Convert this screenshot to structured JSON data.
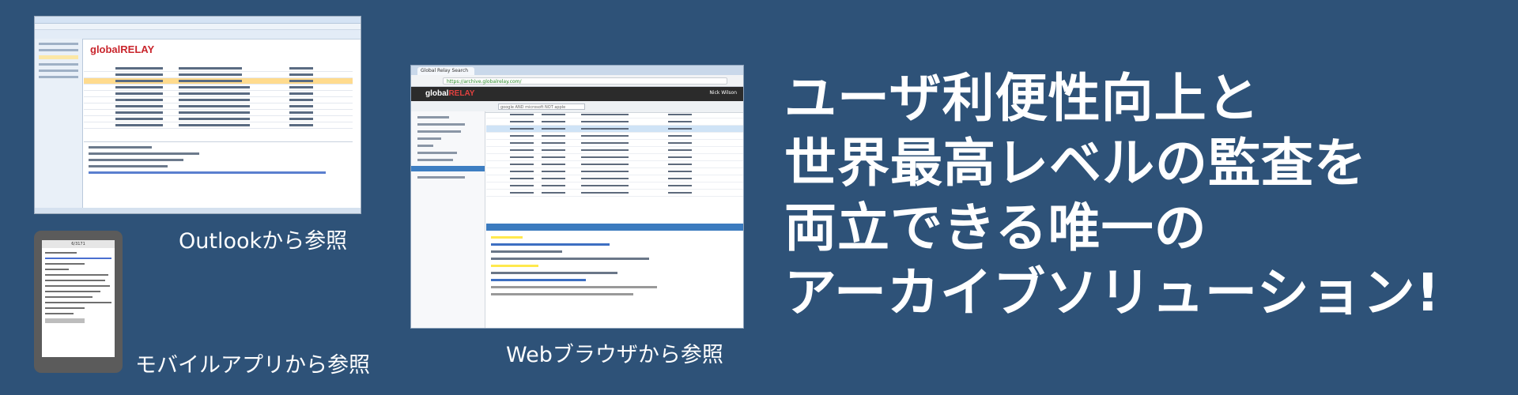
{
  "captions": {
    "outlook": "Outlookから参照",
    "mobile": "モバイルアプリから参照",
    "web": "Webブラウザから参照"
  },
  "headline": {
    "line1": "ユーザ利便性向上と",
    "line2": "世界最高レベルの監査を",
    "line3": "両立できる唯一の",
    "line4": "アーカイブソリューション!"
  },
  "outlook_logo": {
    "part1": "global",
    "part2": "RELAY"
  },
  "browser": {
    "tab_title": "Global Relay Search",
    "url": "https://archive.globalrelay.com/",
    "logo_part1": "global",
    "logo_part2": "RELAY",
    "user_name": "Nick Wilson",
    "search_text": "google AND microsoft NOT apple"
  },
  "phone": {
    "top_title": "6/3171"
  },
  "colors": {
    "background": "#2e5278",
    "brand_red": "#c9252c",
    "highlight_row": "#ffdb8e",
    "accent_blue": "#3b7bbf"
  }
}
